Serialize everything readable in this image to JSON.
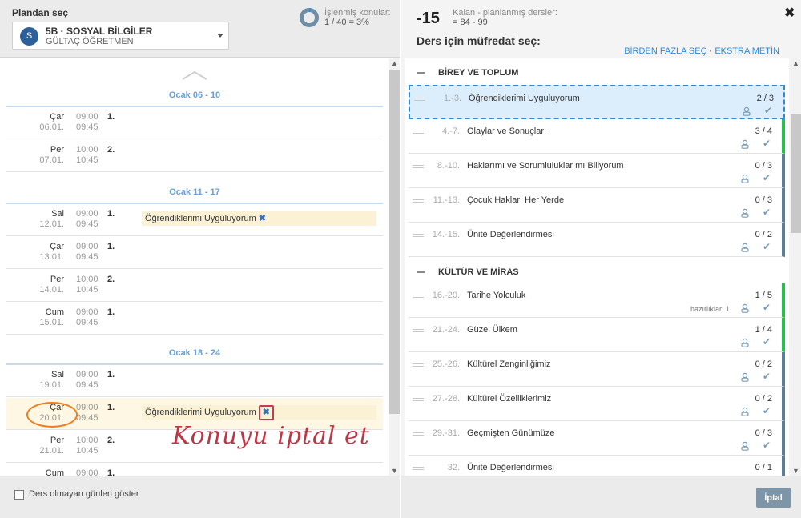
{
  "plan": {
    "label": "Plandan seç",
    "avatar": "S",
    "title": "5B · SOSYAL BİLGİLER",
    "subtitle": "GÜLTAÇ ÖĞRETMEN",
    "progress_label": "İşlenmiş konular:",
    "progress_value": "1 / 40 = 3%",
    "progress_fraction": 0.03
  },
  "weeks": [
    {
      "label": "Ocak 06 - 10"
    },
    {
      "label": "Ocak 11 - 17"
    },
    {
      "label": "Ocak 18 - 24"
    }
  ],
  "lessons": [
    {
      "day": "Çar",
      "date": "06.01.",
      "start": "09:00",
      "end": "09:45",
      "num": "1."
    },
    {
      "day": "Per",
      "date": "07.01.",
      "start": "10:00",
      "end": "10:45",
      "num": "2."
    },
    {
      "day": "Sal",
      "date": "12.01.",
      "start": "09:00",
      "end": "09:45",
      "num": "1.",
      "topic": "Öğrendiklerimi Uyguluyorum"
    },
    {
      "day": "Çar",
      "date": "13.01.",
      "start": "09:00",
      "end": "09:45",
      "num": "1."
    },
    {
      "day": "Per",
      "date": "14.01.",
      "start": "10:00",
      "end": "10:45",
      "num": "2."
    },
    {
      "day": "Cum",
      "date": "15.01.",
      "start": "09:00",
      "end": "09:45",
      "num": "1."
    },
    {
      "day": "Sal",
      "date": "19.01.",
      "start": "09:00",
      "end": "09:45",
      "num": "1."
    },
    {
      "day": "Çar",
      "date": "20.01.",
      "start": "09:00",
      "end": "09:45",
      "num": "1.",
      "topic": "Öğrendiklerimi Uyguluyorum"
    },
    {
      "day": "Per",
      "date": "21.01.",
      "start": "10:00",
      "end": "10:45",
      "num": "2."
    },
    {
      "day": "Cum",
      "date": "",
      "start": "09:00",
      "end": "",
      "num": "1."
    }
  ],
  "annotation": "Konuyu iptal et",
  "footer": {
    "show_days_label": "Ders olmayan günleri göster",
    "cancel_label": "İptal"
  },
  "right_header": {
    "remaining": "-15",
    "remaining_label": "Kalan - planlanmış dersler:",
    "remaining_range": "= 84 - 99",
    "select_title": "Ders için müfredat seç:",
    "link_multi": "BİRDEN FAZLA SEÇ",
    "link_sep": " · ",
    "link_extra": "EKSTRA METİN",
    "close_glyph": "✖"
  },
  "units": [
    {
      "title": "BİREY VE TOPLUM",
      "topics": [
        {
          "range": "1.-3.",
          "title": "Öğrendiklerimi Uyguluyorum",
          "count": "2 / 3"
        },
        {
          "range": "4.-7.",
          "title": "Olaylar ve Sonuçları",
          "count": "3 / 4"
        },
        {
          "range": "8.-10.",
          "title": "Haklarımı ve Sorumluluklarımı Biliyorum",
          "count": "0 / 3"
        },
        {
          "range": "11.-13.",
          "title": "Çocuk Hakları Her Yerde",
          "count": "0 / 3"
        },
        {
          "range": "14.-15.",
          "title": "Ünite Değerlendirmesi",
          "count": "0 / 2"
        }
      ]
    },
    {
      "title": "KÜLTÜR VE MİRAS",
      "topics": [
        {
          "range": "16.-20.",
          "title": "Tarihe Yolculuk",
          "count": "1 / 5",
          "hint": "hazırlıklar: 1"
        },
        {
          "range": "21.-24.",
          "title": "Güzel Ülkem",
          "count": "1 / 4"
        },
        {
          "range": "25.-26.",
          "title": "Kültürel Zenginliğimiz",
          "count": "0 / 2"
        },
        {
          "range": "27.-28.",
          "title": "Kültürel Özelliklerimiz",
          "count": "0 / 2"
        },
        {
          "range": "29.-31.",
          "title": "Geçmişten Günümüze",
          "count": "0 / 3"
        },
        {
          "range": "32.",
          "title": "Ünite Değerlendirmesi",
          "count": "0 / 1"
        }
      ]
    }
  ],
  "icons": {
    "remove": "✖",
    "check": "✔"
  },
  "colors": {
    "accent_blue": "#2e8ad8",
    "week_blue": "#6aa0d6",
    "highlight": "#fdf7e3",
    "done_green": "#2bbd4f",
    "pending_slate": "#5a7e97",
    "annotation_red": "#c03545",
    "circle_orange": "#f07d22"
  }
}
